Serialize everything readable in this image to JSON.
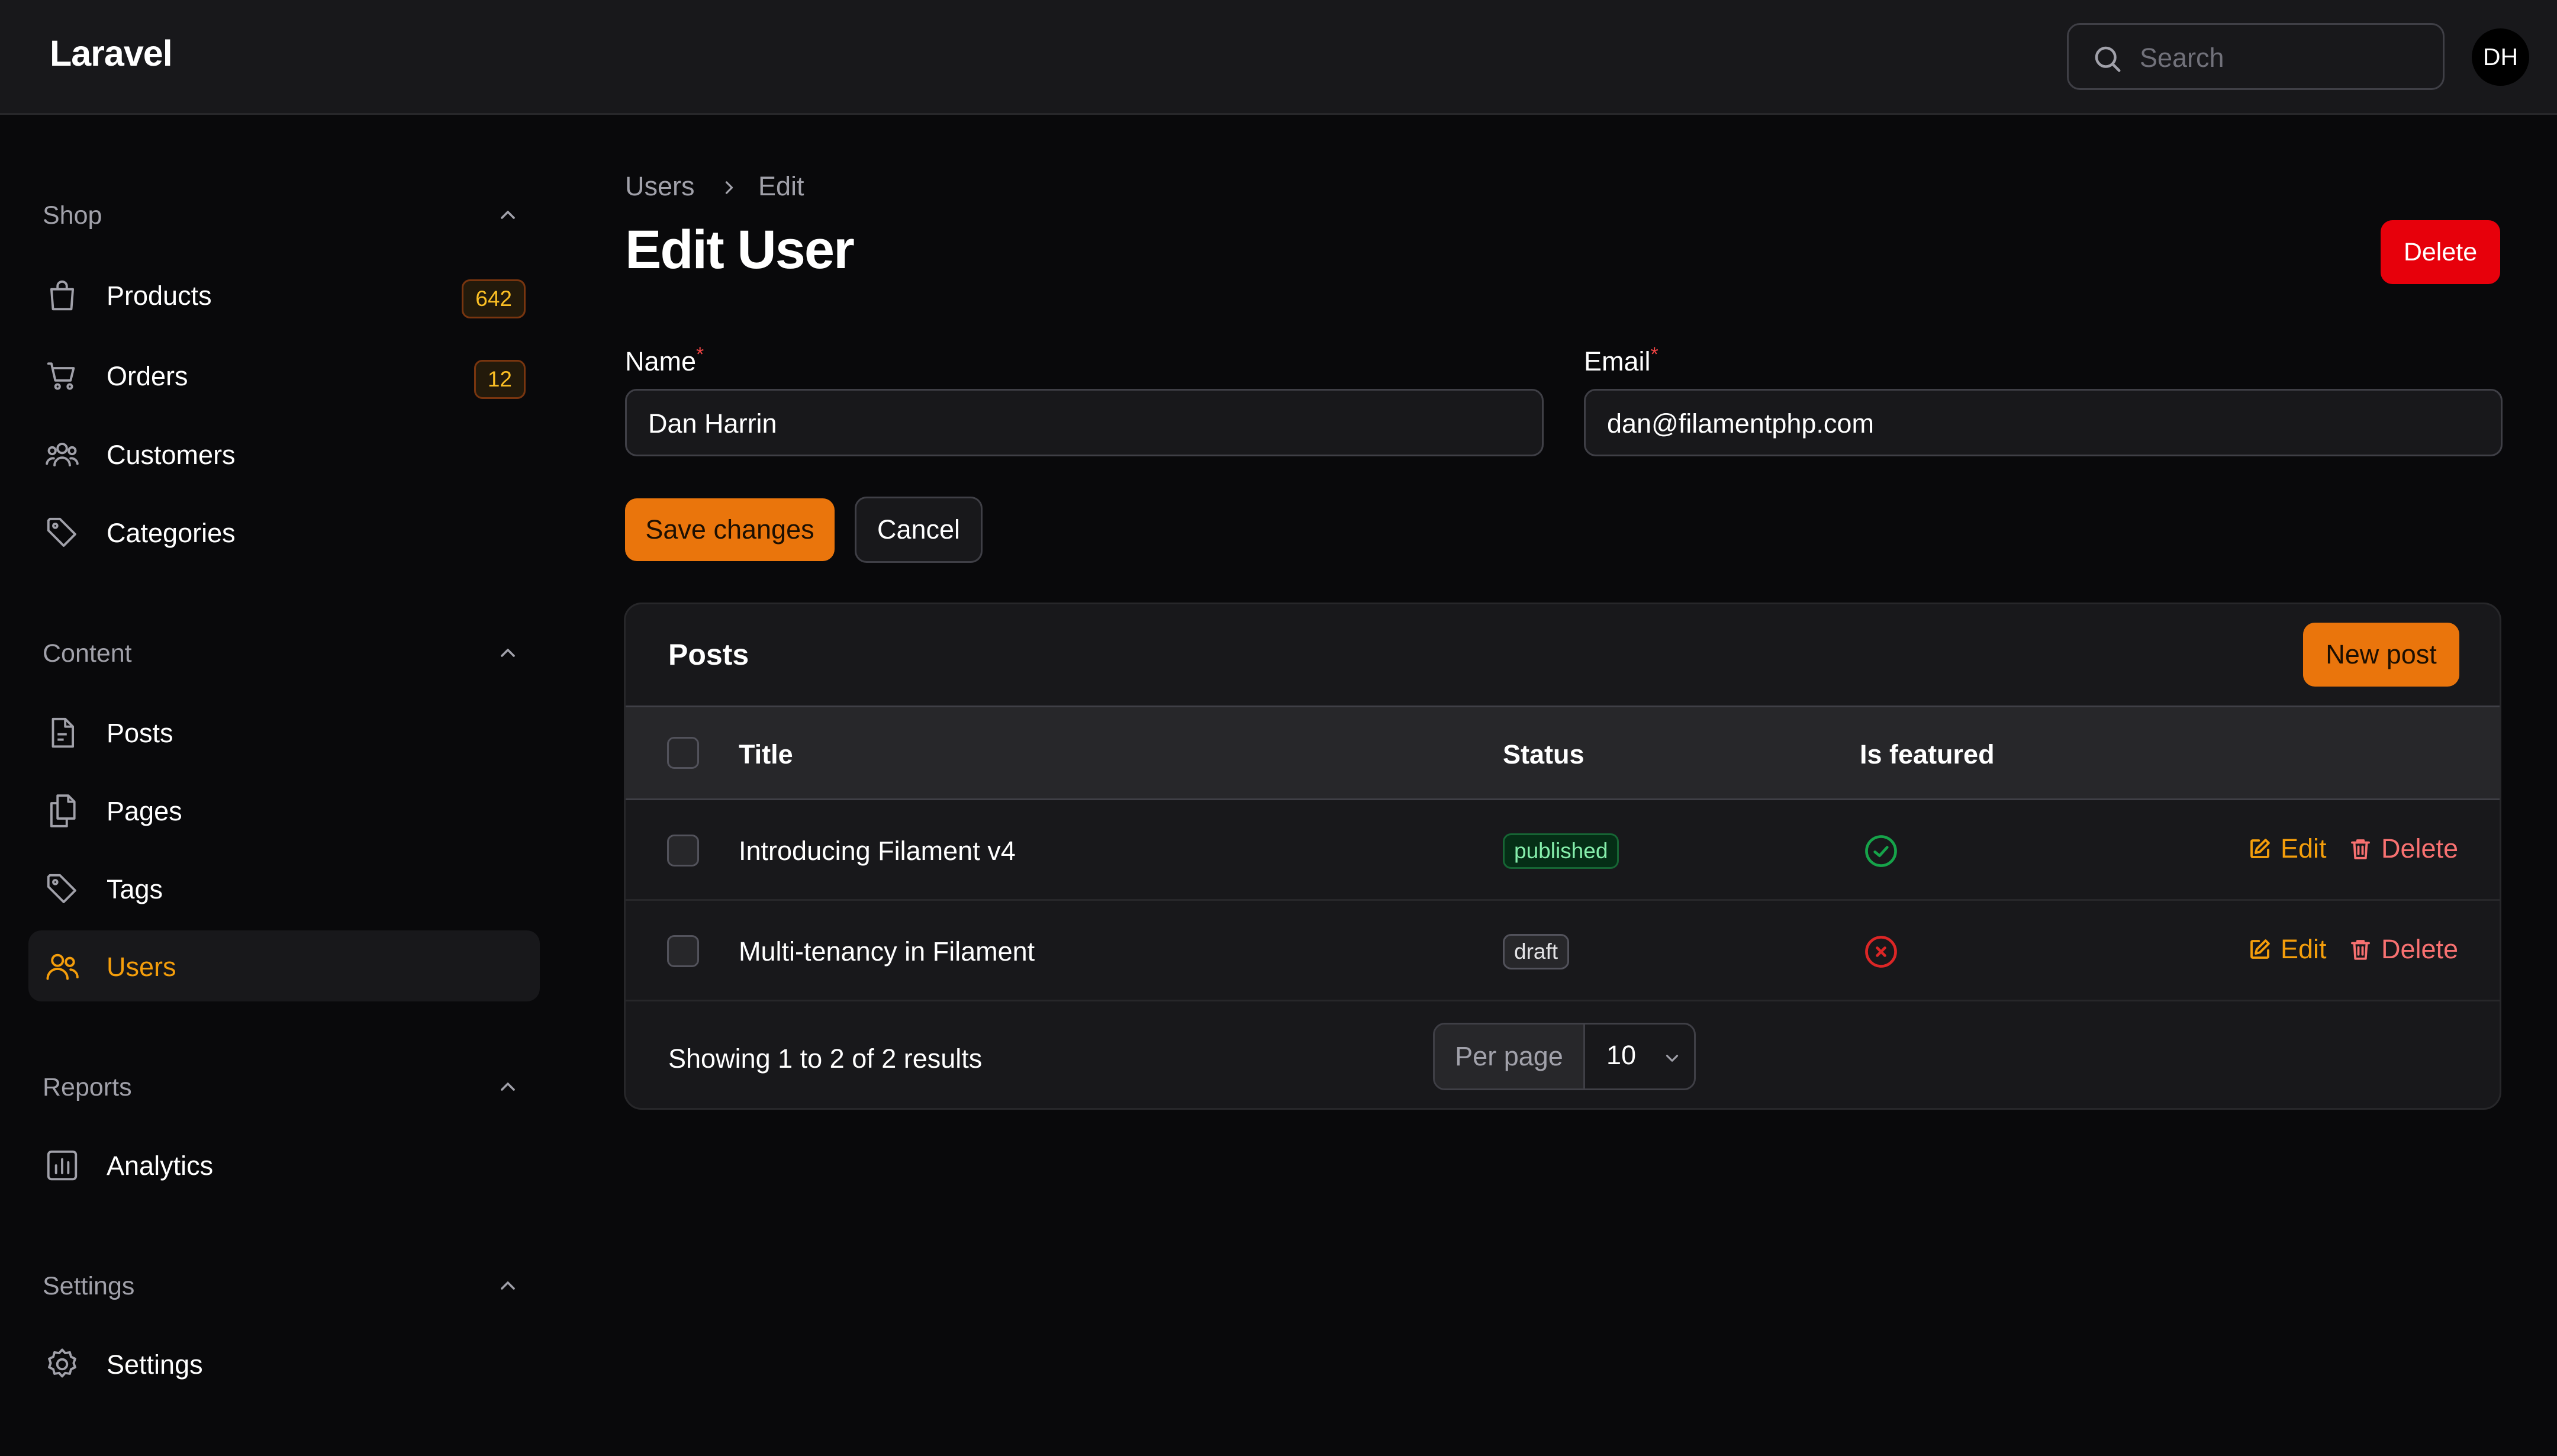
{
  "header": {
    "brand": "Laravel",
    "search_placeholder": "Search",
    "avatar_initials": "DH"
  },
  "sidebar": {
    "groups": [
      {
        "label": "Shop",
        "items": [
          {
            "label": "Products",
            "icon": "shopping-bag-icon",
            "badge": "642"
          },
          {
            "label": "Orders",
            "icon": "shopping-cart-icon",
            "badge": "12"
          },
          {
            "label": "Customers",
            "icon": "users-group-icon"
          },
          {
            "label": "Categories",
            "icon": "tag-icon"
          }
        ]
      },
      {
        "label": "Content",
        "items": [
          {
            "label": "Posts",
            "icon": "document-icon"
          },
          {
            "label": "Pages",
            "icon": "documents-icon"
          },
          {
            "label": "Tags",
            "icon": "tag-icon"
          },
          {
            "label": "Users",
            "icon": "users-icon",
            "active": true
          }
        ]
      },
      {
        "label": "Reports",
        "items": [
          {
            "label": "Analytics",
            "icon": "chart-bar-icon"
          }
        ]
      },
      {
        "label": "Settings",
        "items": [
          {
            "label": "Settings",
            "icon": "gear-icon"
          }
        ]
      }
    ]
  },
  "breadcrumb": [
    "Users",
    "Edit"
  ],
  "page": {
    "title": "Edit User",
    "delete_label": "Delete"
  },
  "form": {
    "name": {
      "label": "Name",
      "value": "Dan Harrin"
    },
    "email": {
      "label": "Email",
      "value": "dan@filamentphp.com"
    },
    "required_marker": "*",
    "save_label": "Save changes",
    "cancel_label": "Cancel"
  },
  "posts": {
    "title": "Posts",
    "new_label": "New post",
    "columns": [
      "Title",
      "Status",
      "Is featured"
    ],
    "rows": [
      {
        "title": "Introducing Filament v4",
        "status": "published",
        "featured": true
      },
      {
        "title": "Multi-tenancy in Filament",
        "status": "draft",
        "featured": false
      }
    ],
    "edit_label": "Edit",
    "delete_label": "Delete",
    "results_text": "Showing 1 to 2 of 2 results",
    "per_page_label": "Per page",
    "per_page_value": "10"
  },
  "colors": {
    "accent": "#f59e0b",
    "primary_button": "#ea750c",
    "danger": "#e7000b",
    "success": "#16a34a",
    "error": "#dc2626"
  }
}
